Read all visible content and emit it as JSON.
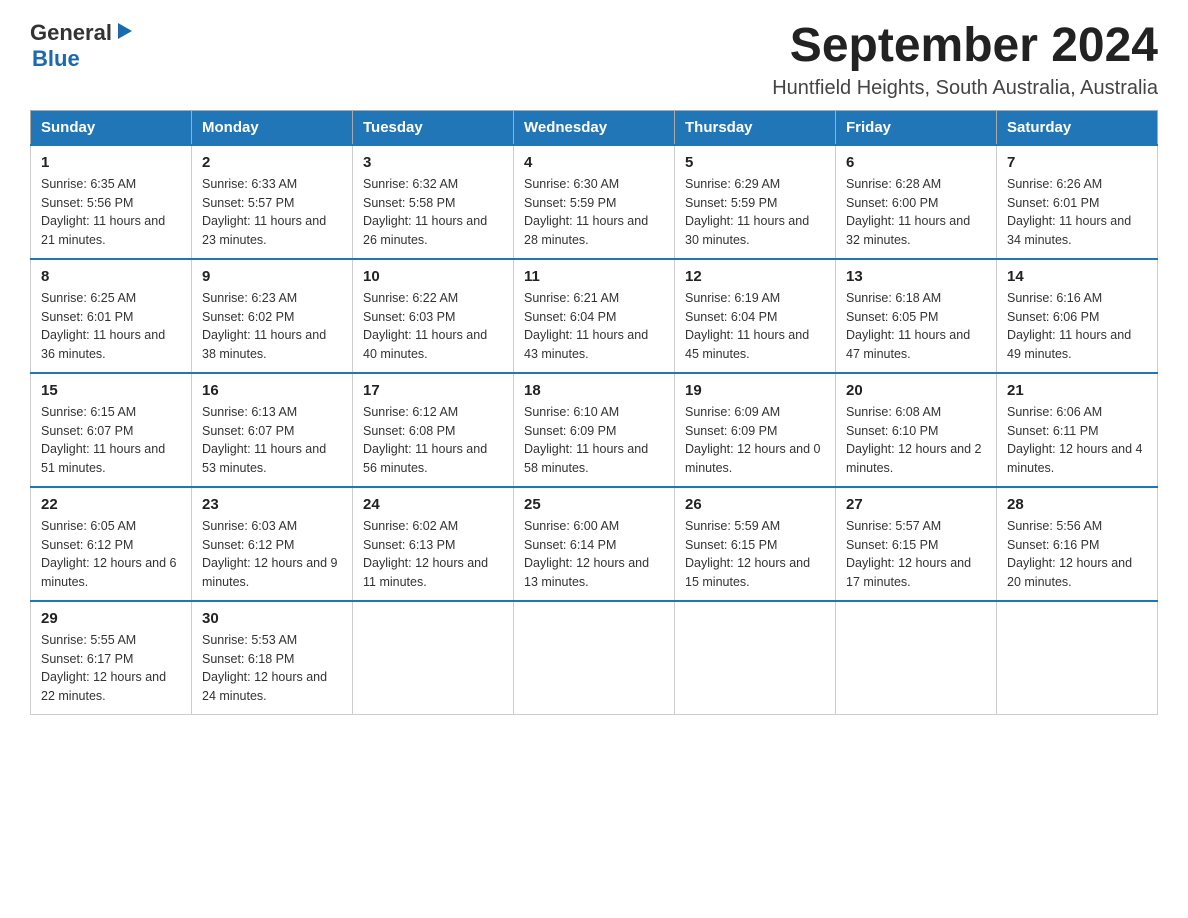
{
  "header": {
    "logo": {
      "general": "General",
      "blue": "Blue"
    },
    "title": "September 2024",
    "subtitle": "Huntfield Heights, South Australia, Australia"
  },
  "calendar": {
    "headers": [
      "Sunday",
      "Monday",
      "Tuesday",
      "Wednesday",
      "Thursday",
      "Friday",
      "Saturday"
    ],
    "weeks": [
      [
        {
          "day": "1",
          "sunrise": "6:35 AM",
          "sunset": "5:56 PM",
          "daylight": "11 hours and 21 minutes."
        },
        {
          "day": "2",
          "sunrise": "6:33 AM",
          "sunset": "5:57 PM",
          "daylight": "11 hours and 23 minutes."
        },
        {
          "day": "3",
          "sunrise": "6:32 AM",
          "sunset": "5:58 PM",
          "daylight": "11 hours and 26 minutes."
        },
        {
          "day": "4",
          "sunrise": "6:30 AM",
          "sunset": "5:59 PM",
          "daylight": "11 hours and 28 minutes."
        },
        {
          "day": "5",
          "sunrise": "6:29 AM",
          "sunset": "5:59 PM",
          "daylight": "11 hours and 30 minutes."
        },
        {
          "day": "6",
          "sunrise": "6:28 AM",
          "sunset": "6:00 PM",
          "daylight": "11 hours and 32 minutes."
        },
        {
          "day": "7",
          "sunrise": "6:26 AM",
          "sunset": "6:01 PM",
          "daylight": "11 hours and 34 minutes."
        }
      ],
      [
        {
          "day": "8",
          "sunrise": "6:25 AM",
          "sunset": "6:01 PM",
          "daylight": "11 hours and 36 minutes."
        },
        {
          "day": "9",
          "sunrise": "6:23 AM",
          "sunset": "6:02 PM",
          "daylight": "11 hours and 38 minutes."
        },
        {
          "day": "10",
          "sunrise": "6:22 AM",
          "sunset": "6:03 PM",
          "daylight": "11 hours and 40 minutes."
        },
        {
          "day": "11",
          "sunrise": "6:21 AM",
          "sunset": "6:04 PM",
          "daylight": "11 hours and 43 minutes."
        },
        {
          "day": "12",
          "sunrise": "6:19 AM",
          "sunset": "6:04 PM",
          "daylight": "11 hours and 45 minutes."
        },
        {
          "day": "13",
          "sunrise": "6:18 AM",
          "sunset": "6:05 PM",
          "daylight": "11 hours and 47 minutes."
        },
        {
          "day": "14",
          "sunrise": "6:16 AM",
          "sunset": "6:06 PM",
          "daylight": "11 hours and 49 minutes."
        }
      ],
      [
        {
          "day": "15",
          "sunrise": "6:15 AM",
          "sunset": "6:07 PM",
          "daylight": "11 hours and 51 minutes."
        },
        {
          "day": "16",
          "sunrise": "6:13 AM",
          "sunset": "6:07 PM",
          "daylight": "11 hours and 53 minutes."
        },
        {
          "day": "17",
          "sunrise": "6:12 AM",
          "sunset": "6:08 PM",
          "daylight": "11 hours and 56 minutes."
        },
        {
          "day": "18",
          "sunrise": "6:10 AM",
          "sunset": "6:09 PM",
          "daylight": "11 hours and 58 minutes."
        },
        {
          "day": "19",
          "sunrise": "6:09 AM",
          "sunset": "6:09 PM",
          "daylight": "12 hours and 0 minutes."
        },
        {
          "day": "20",
          "sunrise": "6:08 AM",
          "sunset": "6:10 PM",
          "daylight": "12 hours and 2 minutes."
        },
        {
          "day": "21",
          "sunrise": "6:06 AM",
          "sunset": "6:11 PM",
          "daylight": "12 hours and 4 minutes."
        }
      ],
      [
        {
          "day": "22",
          "sunrise": "6:05 AM",
          "sunset": "6:12 PM",
          "daylight": "12 hours and 6 minutes."
        },
        {
          "day": "23",
          "sunrise": "6:03 AM",
          "sunset": "6:12 PM",
          "daylight": "12 hours and 9 minutes."
        },
        {
          "day": "24",
          "sunrise": "6:02 AM",
          "sunset": "6:13 PM",
          "daylight": "12 hours and 11 minutes."
        },
        {
          "day": "25",
          "sunrise": "6:00 AM",
          "sunset": "6:14 PM",
          "daylight": "12 hours and 13 minutes."
        },
        {
          "day": "26",
          "sunrise": "5:59 AM",
          "sunset": "6:15 PM",
          "daylight": "12 hours and 15 minutes."
        },
        {
          "day": "27",
          "sunrise": "5:57 AM",
          "sunset": "6:15 PM",
          "daylight": "12 hours and 17 minutes."
        },
        {
          "day": "28",
          "sunrise": "5:56 AM",
          "sunset": "6:16 PM",
          "daylight": "12 hours and 20 minutes."
        }
      ],
      [
        {
          "day": "29",
          "sunrise": "5:55 AM",
          "sunset": "6:17 PM",
          "daylight": "12 hours and 22 minutes."
        },
        {
          "day": "30",
          "sunrise": "5:53 AM",
          "sunset": "6:18 PM",
          "daylight": "12 hours and 24 minutes."
        },
        null,
        null,
        null,
        null,
        null
      ]
    ]
  }
}
